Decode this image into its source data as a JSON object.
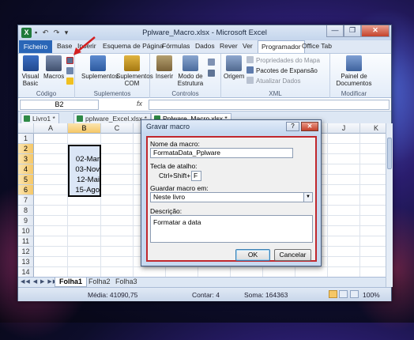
{
  "window": {
    "title": "Pplware_Macro.xlsx - Microsoft Excel",
    "app_icon": "X",
    "controls": {
      "minimize": "—",
      "maximize": "❐",
      "close": "✕"
    }
  },
  "ribbon_tabs": [
    "Ficheiro",
    "Base",
    "Inserir",
    "Esquema de Página",
    "Fórmulas",
    "Dados",
    "Rever",
    "Ver",
    "Programador",
    "Office Tab"
  ],
  "ribbon": {
    "codigo": {
      "label": "Código",
      "visual_basic": "Visual Basic",
      "macros": "Macros"
    },
    "suplementos": {
      "label": "Suplementos",
      "suplementos": "Suplementos",
      "suplementos_com": "Suplementos COM"
    },
    "controlos": {
      "label": "Controlos",
      "inserir": "Inserir",
      "modo_estrutura": "Modo de Estrutura"
    },
    "xml": {
      "label": "XML",
      "origem": "Origem",
      "propriedades_mapa": "Propriedades do Mapa",
      "pacotes_expansao": "Pacotes de Expansão",
      "atualizar_dados": "Atualizar Dados"
    },
    "modificar": {
      "label": "Modificar",
      "painel_documentos": "Painel de Documentos"
    }
  },
  "formula_bar": {
    "name_box": "B2",
    "fx": "fx",
    "value": ""
  },
  "doc_tabs": [
    "Livro1 *",
    "pplware_Excel.xlsx *",
    "Pplware_Macro.xlsx *"
  ],
  "grid": {
    "columns": [
      "A",
      "B",
      "C",
      "D",
      "E",
      "F",
      "G",
      "H",
      "I",
      "J",
      "K"
    ],
    "rows": [
      "1",
      "2",
      "3",
      "4",
      "5",
      "6",
      "7",
      "8",
      "9",
      "10",
      "11",
      "12",
      "13",
      "14"
    ],
    "selected_column": "B",
    "cells_b": [
      {
        "row": "3",
        "value": "02-Mar"
      },
      {
        "row": "4",
        "value": "03-Nov"
      },
      {
        "row": "5",
        "value": "12-Mai"
      },
      {
        "row": "6",
        "value": "15-Ago"
      }
    ]
  },
  "sheet_tabs": [
    "Folha1",
    "Folha2",
    "Folha3"
  ],
  "status_bar": {
    "media": "Média: 41090,75",
    "contar": "Contar: 4",
    "soma": "Soma: 164363",
    "zoom": "100%"
  },
  "dialog": {
    "title": "Gravar macro",
    "help": "?",
    "close": "✕",
    "name_label": "Nome da macro:",
    "name_value": "FormataData_Pplware",
    "shortcut_label": "Tecla de atalho:",
    "shortcut_prefix": "Ctrl+Shift+",
    "shortcut_value": "F",
    "store_label": "Guardar macro em:",
    "store_value": "Neste livro",
    "description_label": "Descrição:",
    "description_value": "Formatar a data",
    "ok": "OK",
    "cancel": "Cancelar"
  },
  "colors": {
    "file_tab": "#2a66b7",
    "highlight_border": "#c0272d",
    "arrow": "#d42020",
    "selection": "#f5c766"
  }
}
